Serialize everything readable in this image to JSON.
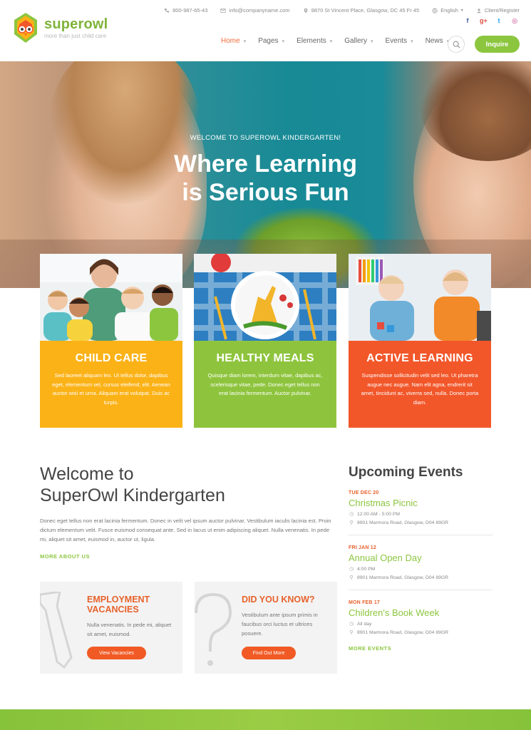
{
  "brand": {
    "name": "superowl",
    "tagline": "more than just child care",
    "colors": {
      "green": "#8cc63f",
      "orange": "#f2572a",
      "yellow": "#fbb217"
    }
  },
  "topbar": {
    "phone": "800-987-65-43",
    "email": "info@companyname.com",
    "address": "9870 St Vincent Place, Glasgow, DC 45 Fr 45",
    "language": "English",
    "account": "Client/Register"
  },
  "social": [
    {
      "icon": "facebook-icon",
      "glyph": "f",
      "color": "#3b5998"
    },
    {
      "icon": "google-plus-icon",
      "glyph": "g+",
      "color": "#dd4b39"
    },
    {
      "icon": "twitter-icon",
      "glyph": "t",
      "color": "#1da1f2"
    },
    {
      "icon": "instagram-icon",
      "glyph": "◎",
      "color": "#c13584"
    }
  ],
  "nav": {
    "items": [
      {
        "label": "Home",
        "active": true
      },
      {
        "label": "Pages"
      },
      {
        "label": "Elements"
      },
      {
        "label": "Gallery"
      },
      {
        "label": "Events"
      },
      {
        "label": "News"
      }
    ],
    "inquire_label": "Inquire"
  },
  "hero": {
    "eyebrow": "WELCOME TO SUPEROWL KINDERGARTEN!",
    "title_line1": "Where Learning",
    "title_line2": "is Serious Fun"
  },
  "features": [
    {
      "title": "CHILD CARE",
      "text": "Sed laoreet aliquam leo. Ut tellus dolor, dapibus eget, elementum vel, cursus eleifend, elit. Aenean auctor wisi et urna. Aliquam erat volutpat. Duis ac turpis."
    },
    {
      "title": "HEALTHY MEALS",
      "text": "Quisque diam lorem, interdum vitae, dapibus ac, scelerisque vitae, pede. Donec eget tellus non erat lacinia fermentum. Auctor pulvinar."
    },
    {
      "title": "ACTIVE LEARNING",
      "text": "Suspendisse sollicitudin velit sed leo. Ut pharetra augue nec augue. Nam elit agna, endrerit sit amet, tincidunt ac, viverra sed, nulla. Donec porta diam."
    }
  ],
  "welcome": {
    "title_line1": "Welcome to",
    "title_line2": "SuperOwl Kindergarten",
    "text": "Donec eget tellus non erat lacinia fermentum. Donec in velit vel ipsum auctor pulvinar. Vestibulum iaculis lacinia est. Proin dictum elementum velit. Fusce euismod consequat ante. Sed in lacus ut enim adipiscing aliquet. Nulla venenatis. In pede mi, aliquet sit amet, euismod in, auctor ut, ligula.",
    "more_label": "MORE ABOUT US"
  },
  "boxes": [
    {
      "title": "EMPLOYMENT VACANCIES",
      "text": "Nulla venenatis. In pede mi, aliquet sit amet, euismod.",
      "button": "View Vacancies"
    },
    {
      "title": "DID YOU KNOW?",
      "text": "Vestibulum ante ipsum primis in faucibus orci luctus et ultrices posuere.",
      "button": "Find Out More"
    }
  ],
  "events": {
    "title": "Upcoming Events",
    "items": [
      {
        "date": "TUE DEC 20",
        "name": "Christmas Picnic",
        "time": "12:00 AM - 5:00 PM",
        "place": "8901 Marmora Road, Glasgow, D04 89GR"
      },
      {
        "date": "FRI JAN 12",
        "name": "Annual Open Day",
        "time": "4:00 PM",
        "place": "8901 Marmora Road, Glasgow, D04 89GR"
      },
      {
        "date": "MON FEB 17",
        "name": "Children's Book Week",
        "time": "All day",
        "place": "8901 Marmora Road, Glasgow, D04 89GR"
      }
    ],
    "more_label": "MORE EVENTS"
  }
}
